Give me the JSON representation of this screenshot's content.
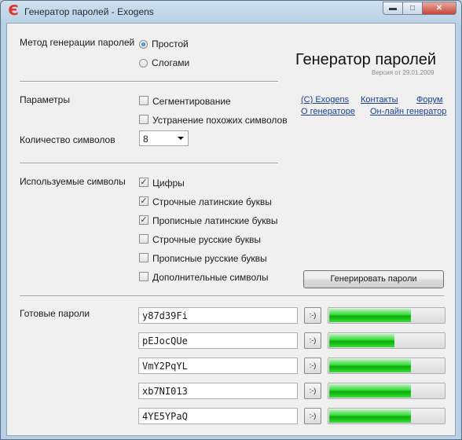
{
  "window": {
    "title": "Генератор паролей - Exogens",
    "controls": [
      "minimize-icon",
      "maximize-icon",
      "close-icon"
    ]
  },
  "method": {
    "label": "Метод генерации паролей",
    "options": [
      {
        "label": "Простой",
        "selected": true
      },
      {
        "label": "Слогами",
        "selected": false
      }
    ]
  },
  "header": {
    "title": "Генератор паролей",
    "version": "Версия от 29.01.2009"
  },
  "links": {
    "copyright": "(C) Exogens",
    "contacts": "Контакты",
    "forum": "Форум",
    "about": "О генераторе",
    "online": "Он-лайн генератор"
  },
  "params": {
    "label": "Параметры",
    "segmentation": {
      "label": "Сегментирование",
      "checked": false
    },
    "similar": {
      "label": "Устранение похожих символов",
      "checked": false
    }
  },
  "length": {
    "label": "Количество символов",
    "value": "8"
  },
  "symbols": {
    "label": "Используемые символы",
    "items": [
      {
        "label": "Цифры",
        "checked": true
      },
      {
        "label": "Строчные латинские буквы",
        "checked": true
      },
      {
        "label": "Прописные латинские буквы",
        "checked": true
      },
      {
        "label": "Строчные русские буквы",
        "checked": false
      },
      {
        "label": "Прописные русские буквы",
        "checked": false
      },
      {
        "label": "Дополнительные символы",
        "checked": false
      }
    ]
  },
  "generate_button": "Генерировать пароли",
  "results": {
    "label": "Готовые пароли",
    "copy_label": ":-)",
    "passwords": [
      {
        "value": "y87d39Fi",
        "strength": 0.7
      },
      {
        "value": "pEJocQUe",
        "strength": 0.56
      },
      {
        "value": "VmY2PqYL",
        "strength": 0.7
      },
      {
        "value": "xb7NI013",
        "strength": 0.7
      },
      {
        "value": "4YE5YPaQ",
        "strength": 0.7
      }
    ]
  },
  "colors": {
    "link": "#1a3f9c",
    "meter_fill": "#1cc41c",
    "close_button": "#c8443a",
    "app_icon": "#e0322a"
  }
}
